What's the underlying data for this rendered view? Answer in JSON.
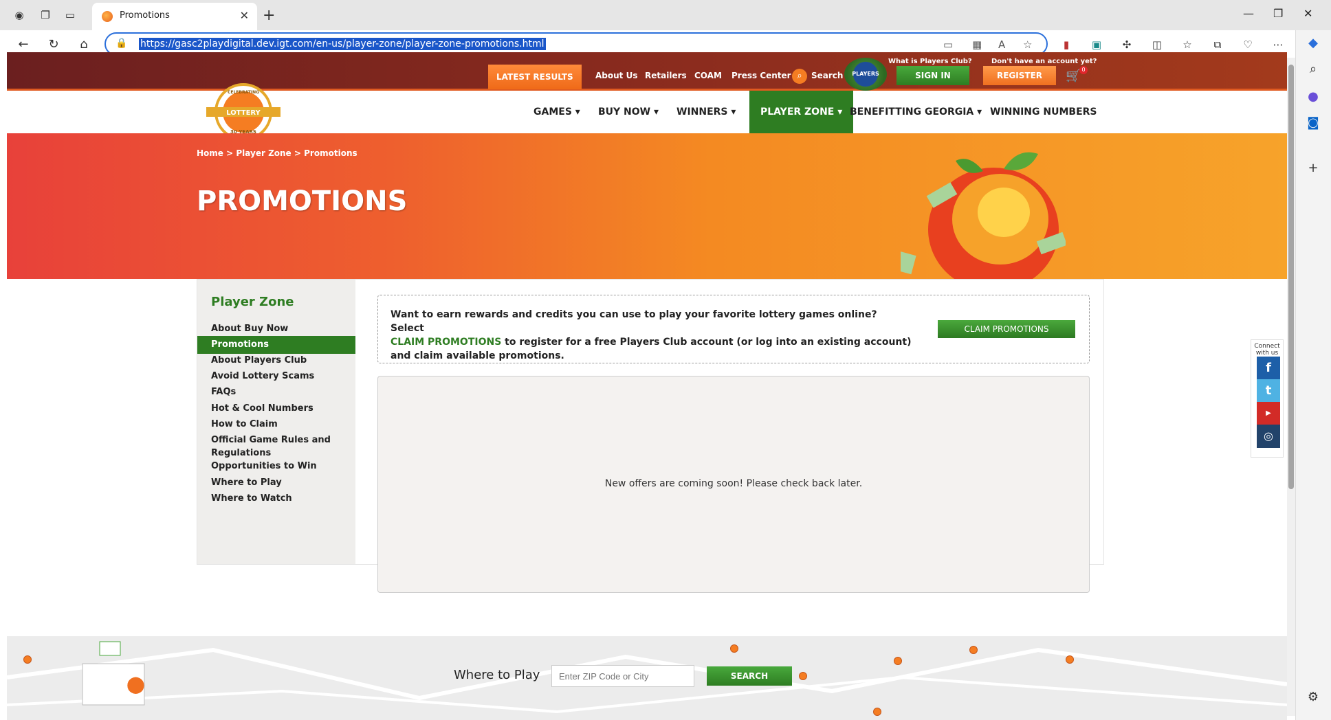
{
  "browser": {
    "tab_title": "Promotions",
    "url": "https://gasc2playdigital.dev.igt.com/en-us/player-zone/player-zone-promotions.html"
  },
  "site": {
    "topbar": {
      "latest_results": "LATEST RESULTS",
      "links": [
        "About Us",
        "Retailers",
        "COAM",
        "Press Center"
      ],
      "search": "Search",
      "players_club_badge": "PLAYERS CLUB",
      "what_is_pc": "What is Players Club?",
      "no_account": "Don't have an account yet?",
      "sign_in": "SIGN IN",
      "register": "REGISTER",
      "cart_count": "0"
    },
    "logo_text": "LOTTERY",
    "logo_arc": "CELEBRATING",
    "logo_years": "30 YEARS",
    "nav": [
      "GAMES",
      "BUY NOW",
      "WINNERS",
      "PLAYER ZONE",
      "BENEFITTING GEORGIA",
      "WINNING NUMBERS"
    ],
    "breadcrumb": {
      "home": "Home",
      "sep": ">",
      "player_zone": "Player Zone",
      "current": "Promotions"
    },
    "page_title": "PROMOTIONS",
    "sidebar": {
      "heading": "Player Zone",
      "items": [
        "About Buy Now",
        "Promotions",
        "About Players Club",
        "Avoid Lottery Scams",
        "FAQs",
        "Hot & Cool Numbers",
        "How to Claim",
        "Official Game Rules and Regulations",
        "Opportunities to Win",
        "Where to Play",
        "Where to Watch"
      ]
    },
    "promo": {
      "text_before": "Want to earn rewards and credits you can use to play your favorite lottery games online? Select",
      "link": "CLAIM PROMOTIONS",
      "text_after": "to register for a free Players Club account (or log into an existing account) and claim available promotions.",
      "button": "CLAIM PROMOTIONS"
    },
    "offers_message": "New offers are coming soon! Please check back later.",
    "social": {
      "label": "Connect with us",
      "icons": [
        "facebook-icon",
        "twitter-icon",
        "youtube-icon",
        "instagram-icon"
      ]
    },
    "where_to_play": {
      "label": "Where to Play",
      "placeholder": "Enter ZIP Code or City",
      "button": "SEARCH"
    }
  },
  "colors": {
    "brand_green": "#2e7d22",
    "brand_orange": "#f57d22",
    "topbar_maroon": "#6b1f1f"
  }
}
